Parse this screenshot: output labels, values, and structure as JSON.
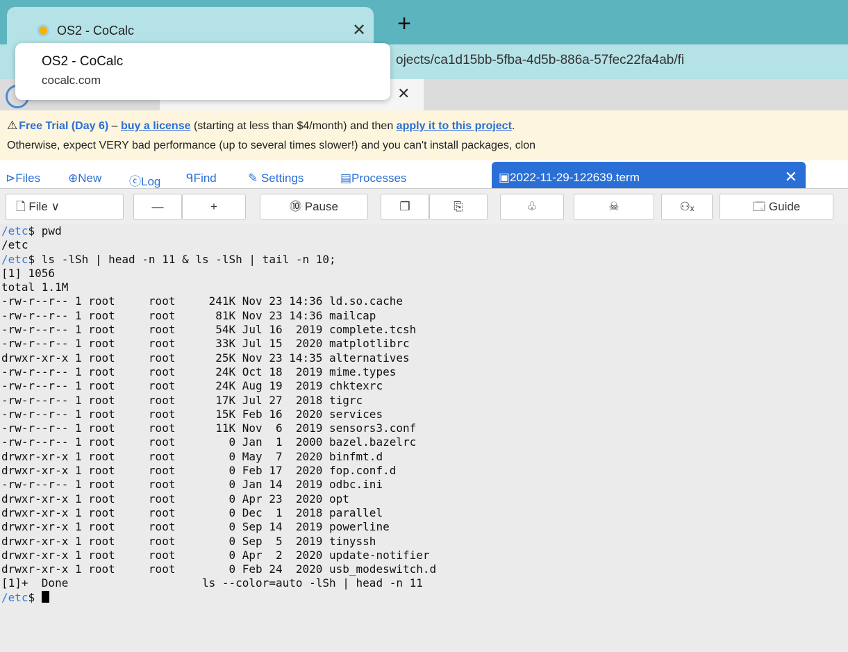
{
  "browser": {
    "tab_title": "OS2 - CoCalc",
    "tab_close": "✕",
    "new_tab": "+",
    "url_visible": "ojects/ca1d15bb-5fba-4d5b-886a-57fec22fa4ab/fi",
    "tooltip": {
      "title": "OS2 - CoCalc",
      "domain": "cocalc.com"
    }
  },
  "cocalc_tab": {
    "close": "✕"
  },
  "banner": {
    "warn": "⚠",
    "trial": "Free Trial (Day 6)",
    "dash": " – ",
    "buy": "buy a license",
    "mid": " (starting at less than $4/month) and then ",
    "apply": "apply it to this project",
    "end": ".",
    "line2": "Otherwise, expect VERY bad performance (up to several times slower!) and you can't install packages, clon"
  },
  "nav": {
    "files": "⊳Files",
    "new": "⊕New",
    "log": "ⓒLog",
    "find": "ᑫFind",
    "settings": "✎ Settings",
    "processes": "▤Processes",
    "term_tab": "▣2022-11-29-122639.term",
    "term_close": "✕"
  },
  "toolbar": {
    "file": "🗋 File ∨",
    "minus": "—",
    "plus": "+",
    "pause": "⓾ Pause",
    "copy": "❐",
    "paste": "⎘",
    "bell": "♧",
    "kill": "☠",
    "users": "⚇ₓ",
    "guide": "🗔 Guide"
  },
  "terminal": {
    "prompt": "/etc",
    "lines": [
      {
        "prompt": "/etc",
        "text": "$ pwd"
      },
      {
        "text": "/etc"
      },
      {
        "prompt": "/etc",
        "text": "$ ls -lSh | head -n 11 & ls -lSh | tail -n 10;"
      },
      {
        "text": "[1] 1056"
      },
      {
        "text": "total 1.1M"
      },
      {
        "text": "-rw-r--r-- 1 root     root     241K Nov 23 14:36 ld.so.cache"
      },
      {
        "text": "-rw-r--r-- 1 root     root      81K Nov 23 14:36 mailcap"
      },
      {
        "text": "-rw-r--r-- 1 root     root      54K Jul 16  2019 complete.tcsh"
      },
      {
        "text": "-rw-r--r-- 1 root     root      33K Jul 15  2020 matplotlibrc"
      },
      {
        "text": "drwxr-xr-x 1 root     root      25K Nov 23 14:35 alternatives"
      },
      {
        "text": "-rw-r--r-- 1 root     root      24K Oct 18  2019 mime.types"
      },
      {
        "text": "-rw-r--r-- 1 root     root      24K Aug 19  2019 chktexrc"
      },
      {
        "text": "-rw-r--r-- 1 root     root      17K Jul 27  2018 tigrc"
      },
      {
        "text": "-rw-r--r-- 1 root     root      15K Feb 16  2020 services"
      },
      {
        "text": "-rw-r--r-- 1 root     root      11K Nov  6  2019 sensors3.conf"
      },
      {
        "text": "-rw-r--r-- 1 root     root        0 Jan  1  2000 bazel.bazelrc"
      },
      {
        "text": "drwxr-xr-x 1 root     root        0 May  7  2020 binfmt.d"
      },
      {
        "text": "drwxr-xr-x 1 root     root        0 Feb 17  2020 fop.conf.d"
      },
      {
        "text": "-rw-r--r-- 1 root     root        0 Jan 14  2019 odbc.ini"
      },
      {
        "text": "drwxr-xr-x 1 root     root        0 Apr 23  2020 opt"
      },
      {
        "text": "drwxr-xr-x 1 root     root        0 Dec  1  2018 parallel"
      },
      {
        "text": "drwxr-xr-x 1 root     root        0 Sep 14  2019 powerline"
      },
      {
        "text": "drwxr-xr-x 1 root     root        0 Sep  5  2019 tinyssh"
      },
      {
        "text": "drwxr-xr-x 1 root     root        0 Apr  2  2020 update-notifier"
      },
      {
        "text": "drwxr-xr-x 1 root     root        0 Feb 24  2020 usb_modeswitch.d"
      },
      {
        "text": "[1]+  Done                    ls --color=auto -lSh | head -n 11"
      },
      {
        "prompt": "/etc",
        "text": "$ ",
        "cursor": true
      }
    ]
  }
}
